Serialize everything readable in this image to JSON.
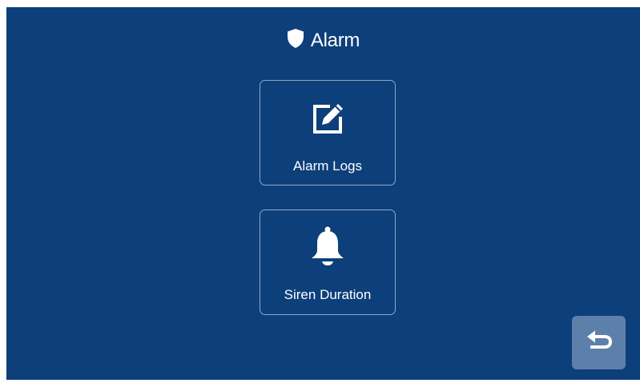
{
  "header": {
    "title": "Alarm",
    "icon": "shield-icon"
  },
  "menu": {
    "items": [
      {
        "label": "Alarm Logs",
        "icon": "edit-icon"
      },
      {
        "label": "Siren Duration",
        "icon": "bell-icon"
      }
    ]
  },
  "footer": {
    "back_icon": "back-arrow-icon"
  },
  "colors": {
    "background": "#0d3f7a",
    "tile_border": "#b6c6da",
    "back_button": "#5d80ab",
    "text": "#ffffff"
  }
}
